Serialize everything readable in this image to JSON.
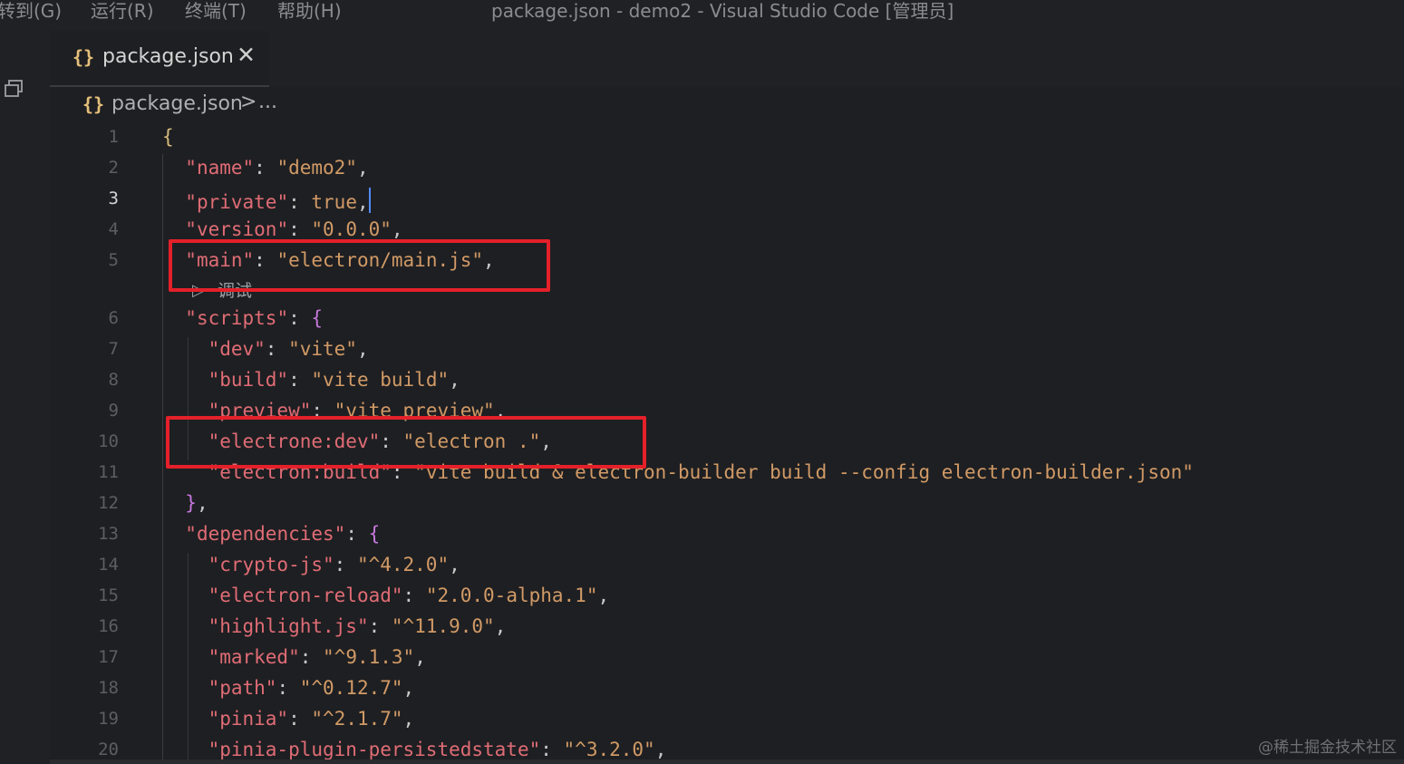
{
  "menu": {
    "items": [
      {
        "label": "转到(G)"
      },
      {
        "label": "运行(R)"
      },
      {
        "label": "终端(T)"
      },
      {
        "label": "帮助(H)"
      }
    ]
  },
  "window_title": "package.json - demo2 - Visual Studio Code [管理员]",
  "tab": {
    "label": "package.json",
    "icon": "json-braces-icon",
    "close_icon": "close-icon"
  },
  "breadcrumb": {
    "file": "package.json",
    "separator": ">",
    "ellipsis": "..."
  },
  "editor": {
    "active_line": 3,
    "lines": [
      {
        "num": "1",
        "parts": [
          [
            "brace-yellow",
            "{"
          ]
        ]
      },
      {
        "num": "2",
        "parts": [
          [
            "p",
            "  "
          ],
          [
            "k",
            "\"name\""
          ],
          [
            "p",
            ": "
          ],
          [
            "s",
            "\"demo2\""
          ],
          [
            "p",
            ","
          ]
        ]
      },
      {
        "num": "3",
        "parts": [
          [
            "p",
            "  "
          ],
          [
            "k",
            "\"private\""
          ],
          [
            "p",
            ": "
          ],
          [
            "b",
            "true"
          ],
          [
            "p",
            ","
          ]
        ]
      },
      {
        "num": "4",
        "parts": [
          [
            "p",
            "  "
          ],
          [
            "k",
            "\"version\""
          ],
          [
            "p",
            ": "
          ],
          [
            "s",
            "\"0.0.0\""
          ],
          [
            "p",
            ","
          ]
        ]
      },
      {
        "num": "5",
        "parts": [
          [
            "p",
            "  "
          ],
          [
            "k",
            "\"main\""
          ],
          [
            "p",
            ": "
          ],
          [
            "s",
            "\"electron/main.js\""
          ],
          [
            "p",
            ","
          ]
        ]
      },
      {
        "num": "6",
        "parts": [
          [
            "p",
            "  "
          ],
          [
            "k",
            "\"scripts\""
          ],
          [
            "p",
            ": "
          ],
          [
            "brace",
            "{"
          ]
        ]
      },
      {
        "num": "7",
        "parts": [
          [
            "p",
            "    "
          ],
          [
            "k",
            "\"dev\""
          ],
          [
            "p",
            ": "
          ],
          [
            "s",
            "\"vite\""
          ],
          [
            "p",
            ","
          ]
        ]
      },
      {
        "num": "8",
        "parts": [
          [
            "p",
            "    "
          ],
          [
            "k",
            "\"build\""
          ],
          [
            "p",
            ": "
          ],
          [
            "s",
            "\"vite build\""
          ],
          [
            "p",
            ","
          ]
        ]
      },
      {
        "num": "9",
        "parts": [
          [
            "p",
            "    "
          ],
          [
            "k",
            "\"preview\""
          ],
          [
            "p",
            ": "
          ],
          [
            "s",
            "\"vite preview\""
          ],
          [
            "p",
            ","
          ]
        ]
      },
      {
        "num": "10",
        "parts": [
          [
            "p",
            "    "
          ],
          [
            "k",
            "\"electrone:dev\""
          ],
          [
            "p",
            ": "
          ],
          [
            "s",
            "\"electron .\""
          ],
          [
            "p",
            ","
          ]
        ]
      },
      {
        "num": "11",
        "parts": [
          [
            "p",
            "    "
          ],
          [
            "k",
            "\"electron:build\""
          ],
          [
            "p",
            ": "
          ],
          [
            "s",
            "\"vite build & electron-builder build --config electron-builder.json\""
          ]
        ]
      },
      {
        "num": "12",
        "parts": [
          [
            "p",
            "  "
          ],
          [
            "brace",
            "}"
          ],
          [
            "p",
            ","
          ]
        ]
      },
      {
        "num": "13",
        "parts": [
          [
            "p",
            "  "
          ],
          [
            "k",
            "\"dependencies\""
          ],
          [
            "p",
            ": "
          ],
          [
            "brace",
            "{"
          ]
        ]
      },
      {
        "num": "14",
        "parts": [
          [
            "p",
            "    "
          ],
          [
            "k",
            "\"crypto-js\""
          ],
          [
            "p",
            ": "
          ],
          [
            "s",
            "\"^4.2.0\""
          ],
          [
            "p",
            ","
          ]
        ]
      },
      {
        "num": "15",
        "parts": [
          [
            "p",
            "    "
          ],
          [
            "k",
            "\"electron-reload\""
          ],
          [
            "p",
            ": "
          ],
          [
            "s",
            "\"2.0.0-alpha.1\""
          ],
          [
            "p",
            ","
          ]
        ]
      },
      {
        "num": "16",
        "parts": [
          [
            "p",
            "    "
          ],
          [
            "k",
            "\"highlight.js\""
          ],
          [
            "p",
            ": "
          ],
          [
            "s",
            "\"^11.9.0\""
          ],
          [
            "p",
            ","
          ]
        ]
      },
      {
        "num": "17",
        "parts": [
          [
            "p",
            "    "
          ],
          [
            "k",
            "\"marked\""
          ],
          [
            "p",
            ": "
          ],
          [
            "s",
            "\"^9.1.3\""
          ],
          [
            "p",
            ","
          ]
        ]
      },
      {
        "num": "18",
        "parts": [
          [
            "p",
            "    "
          ],
          [
            "k",
            "\"path\""
          ],
          [
            "p",
            ": "
          ],
          [
            "s",
            "\"^0.12.7\""
          ],
          [
            "p",
            ","
          ]
        ]
      },
      {
        "num": "19",
        "parts": [
          [
            "p",
            "    "
          ],
          [
            "k",
            "\"pinia\""
          ],
          [
            "p",
            ": "
          ],
          [
            "s",
            "\"^2.1.7\""
          ],
          [
            "p",
            ","
          ]
        ]
      },
      {
        "num": "20",
        "parts": [
          [
            "p",
            "    "
          ],
          [
            "k",
            "\"pinia-plugin-persistedstate\""
          ],
          [
            "p",
            ": "
          ],
          [
            "s",
            "\"^3.2.0\""
          ],
          [
            "p",
            ","
          ]
        ]
      }
    ],
    "codelens": {
      "label": "调试",
      "icon": "play-icon"
    }
  },
  "watermark": "@稀土掘金技术社区",
  "colors": {
    "highlight_box": "#e4202a",
    "cursor": "#528bff"
  }
}
